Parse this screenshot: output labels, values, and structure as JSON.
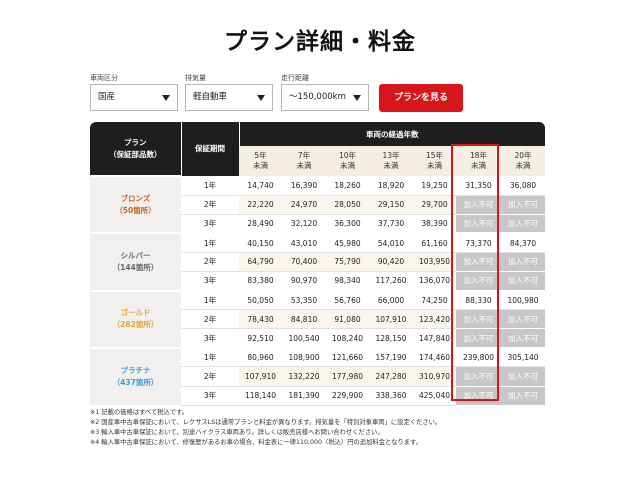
{
  "page": {
    "title": "プラン詳細・料金"
  },
  "filters": [
    {
      "label": "車両区分",
      "value": "国産"
    },
    {
      "label": "排気量",
      "value": "軽自動車"
    },
    {
      "label": "走行距離",
      "value": "〜150,000km"
    }
  ],
  "show_button": "プランを見る",
  "table": {
    "plan_header": [
      "プラン",
      "（保証部品数）"
    ],
    "period_header": "保証期間",
    "years_header": "車両の経過年数",
    "year_columns": [
      [
        "5年",
        "未満"
      ],
      [
        "7年",
        "未満"
      ],
      [
        "10年",
        "未満"
      ],
      [
        "13年",
        "未満"
      ],
      [
        "15年",
        "未満"
      ],
      [
        "18年",
        "未満"
      ],
      [
        "20年",
        "未満"
      ]
    ],
    "plans": [
      {
        "name": "ブロンズ",
        "parts": "（50箇所）",
        "color": "#c8642a",
        "rows": [
          {
            "period": "1年",
            "prices": [
              "14,740",
              "16,390",
              "18,260",
              "18,920",
              "19,250",
              "31,350",
              "36,080"
            ]
          },
          {
            "period": "2年",
            "prices": [
              "22,220",
              "24,970",
              "28,050",
              "29,150",
              "29,700",
              "加入不可",
              "加入不可"
            ]
          },
          {
            "period": "3年",
            "prices": [
              "28,490",
              "32,120",
              "36,300",
              "37,730",
              "38,390",
              "加入不可",
              "加入不可"
            ]
          }
        ]
      },
      {
        "name": "シルバー",
        "parts": "（144箇所）",
        "color": "#666666",
        "rows": [
          {
            "period": "1年",
            "prices": [
              "40,150",
              "43,010",
              "45,980",
              "54,010",
              "61,160",
              "73,370",
              "84,370"
            ]
          },
          {
            "period": "2年",
            "prices": [
              "64,790",
              "70,400",
              "75,790",
              "90,420",
              "103,950",
              "加入不可",
              "加入不可"
            ]
          },
          {
            "period": "3年",
            "prices": [
              "83,380",
              "90,970",
              "98,340",
              "117,260",
              "136,070",
              "加入不可",
              "加入不可"
            ]
          }
        ]
      },
      {
        "name": "ゴールド",
        "parts": "（282箇所）",
        "color": "#e8a23a",
        "rows": [
          {
            "period": "1年",
            "prices": [
              "50,050",
              "53,350",
              "56,760",
              "66,000",
              "74,250",
              "88,330",
              "100,980"
            ]
          },
          {
            "period": "2年",
            "prices": [
              "78,430",
              "84,810",
              "91,080",
              "107,910",
              "123,420",
              "加入不可",
              "加入不可"
            ]
          },
          {
            "period": "3年",
            "prices": [
              "92,510",
              "100,540",
              "108,240",
              "128,150",
              "147,840",
              "加入不可",
              "加入不可"
            ]
          }
        ]
      },
      {
        "name": "プラチナ",
        "parts": "（437箇所）",
        "color": "#3d9ed3",
        "rows": [
          {
            "period": "1年",
            "prices": [
              "80,960",
              "108,900",
              "121,660",
              "157,190",
              "174,460",
              "239,800",
              "305,140"
            ]
          },
          {
            "period": "2年",
            "prices": [
              "107,910",
              "132,220",
              "177,980",
              "247,280",
              "310,970",
              "加入不可",
              "加入不可"
            ]
          },
          {
            "period": "3年",
            "prices": [
              "118,140",
              "181,390",
              "229,900",
              "338,360",
              "425,040",
              "加入不可",
              "加入不可"
            ]
          }
        ]
      }
    ]
  },
  "notes": [
    "※1 記載の価格はすべて税込です。",
    "※2 国産車中古車保証において、レクサスLSは通常プランと料金が異なります。排気量を「特別対象車両」に設定ください。",
    "※3 輸入車中古車保証において、別途ハイクラス車両あり。詳しくは販売店様へお問い合わせください。",
    "※4 輸入車中古車保証において、修復歴があるお車の場合、料金表に一律110,000（税込）円の追加料金となります。"
  ],
  "colors": {
    "accent": "#d7161c",
    "header": "#1f1d1d",
    "unavailable": "#c7c7c7"
  }
}
